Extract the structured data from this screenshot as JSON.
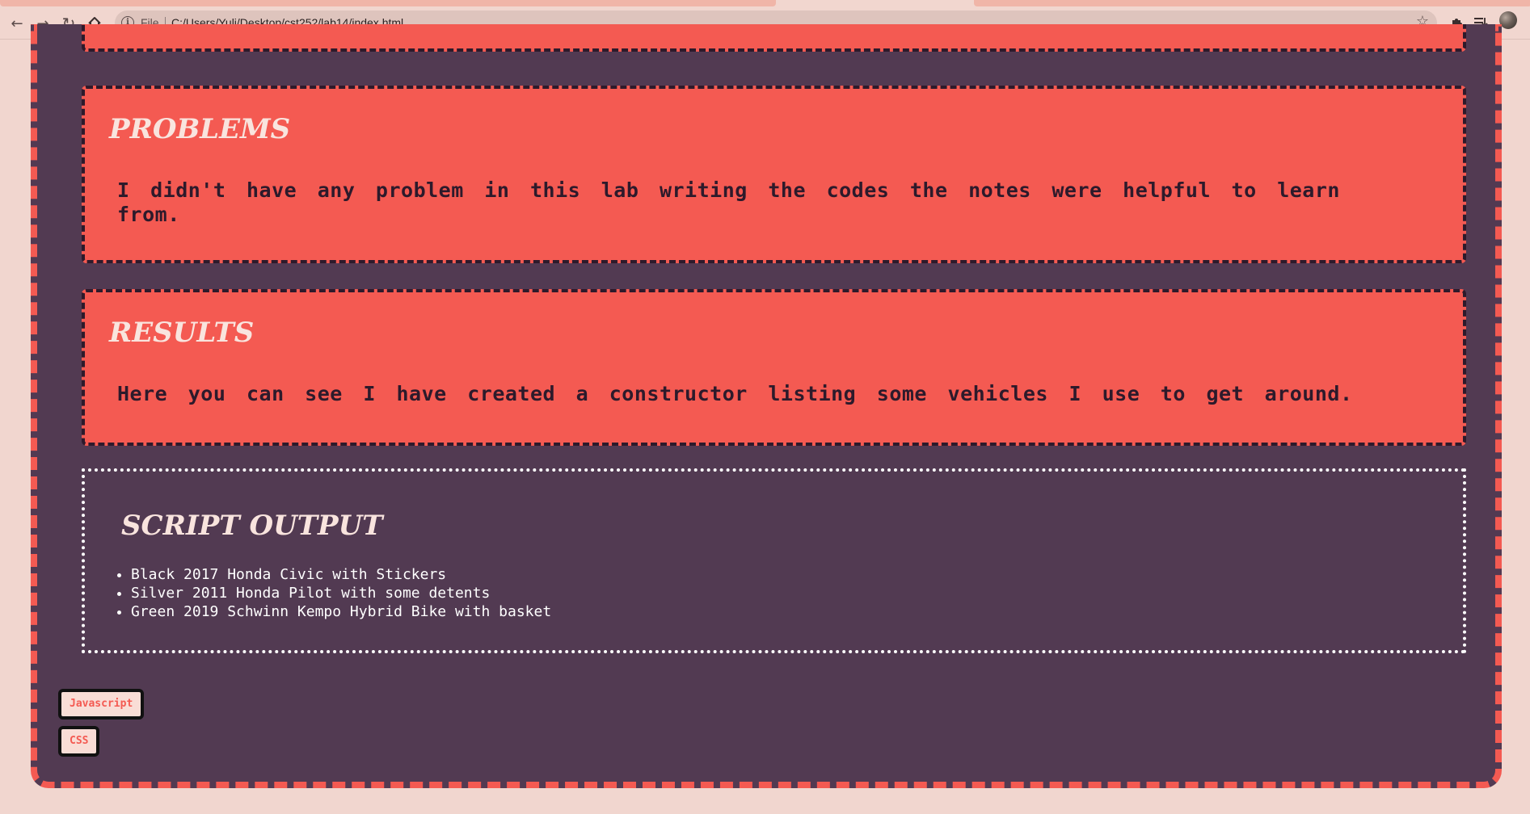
{
  "browser": {
    "scheme_label": "File",
    "url": "C:/Users/Yuli/Desktop/cst252/lab14/index.html",
    "icons": {
      "back": "arrow-left-icon",
      "forward": "arrow-right-icon",
      "reload": "reload-icon",
      "home": "home-icon",
      "info": "info-icon",
      "bookmark": "star-icon",
      "extensions": "puzzle-icon",
      "reading_list": "reading-list-icon",
      "profile": "avatar"
    }
  },
  "sections": {
    "problems": {
      "heading": "PROBLEMS",
      "text": "I didn't have any problem in this lab writing the codes the notes were helpful to learn from."
    },
    "results": {
      "heading": "RESULTS",
      "text": "Here you can see I have created a constructor listing some vehicles I use to get around."
    }
  },
  "script_output": {
    "heading": "SCRIPT OUTPUT",
    "items": [
      "Black 2017 Honda Civic with Stickers",
      "Silver 2011 Honda Pilot with some detents",
      "Green 2019 Schwinn Kempo Hybrid Bike with basket"
    ]
  },
  "footer_links": {
    "javascript": "Javascript",
    "css": "CSS"
  },
  "colors": {
    "page_background": "#f1d6cf",
    "container": "#523a52",
    "accent": "#f45a52",
    "dark_border": "#2d1a2b",
    "heading_text": "#f9e4de"
  }
}
